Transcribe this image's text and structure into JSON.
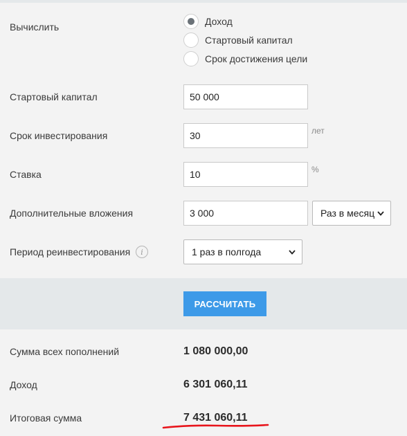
{
  "calculate": {
    "label": "Вычислить",
    "options": [
      {
        "label": "Доход",
        "checked": true
      },
      {
        "label": "Стартовый капитал",
        "checked": false
      },
      {
        "label": "Срок достижения цели",
        "checked": false
      }
    ]
  },
  "fields": {
    "start_capital": {
      "label": "Стартовый капитал",
      "value": "50 000"
    },
    "term": {
      "label": "Срок инвестирования",
      "value": "30",
      "unit": "лет"
    },
    "rate": {
      "label": "Ставка",
      "value": "10",
      "unit": "%"
    },
    "additional": {
      "label": "Дополнительные вложения",
      "value": "3 000",
      "frequency": "Раз в месяц"
    },
    "reinvest": {
      "label": "Период реинвестирования",
      "value": "1 раз в полгода"
    }
  },
  "button": {
    "label": "РАССЧИТАТЬ"
  },
  "results": {
    "total_deposits": {
      "label": "Сумма всех пополнений",
      "value": "1 080 000,00"
    },
    "income": {
      "label": "Доход",
      "value": "6 301 060,11"
    },
    "final_sum": {
      "label": "Итоговая сумма",
      "value": "7 431 060,11"
    }
  },
  "colors": {
    "accent_button": "#3d9ae8",
    "annotation_underline": "#e8141b",
    "background": "#f3f3f3",
    "band": "#e4e8ea"
  },
  "icons": {
    "info": "info-icon",
    "select_arrow": "chevron-down-icon"
  }
}
